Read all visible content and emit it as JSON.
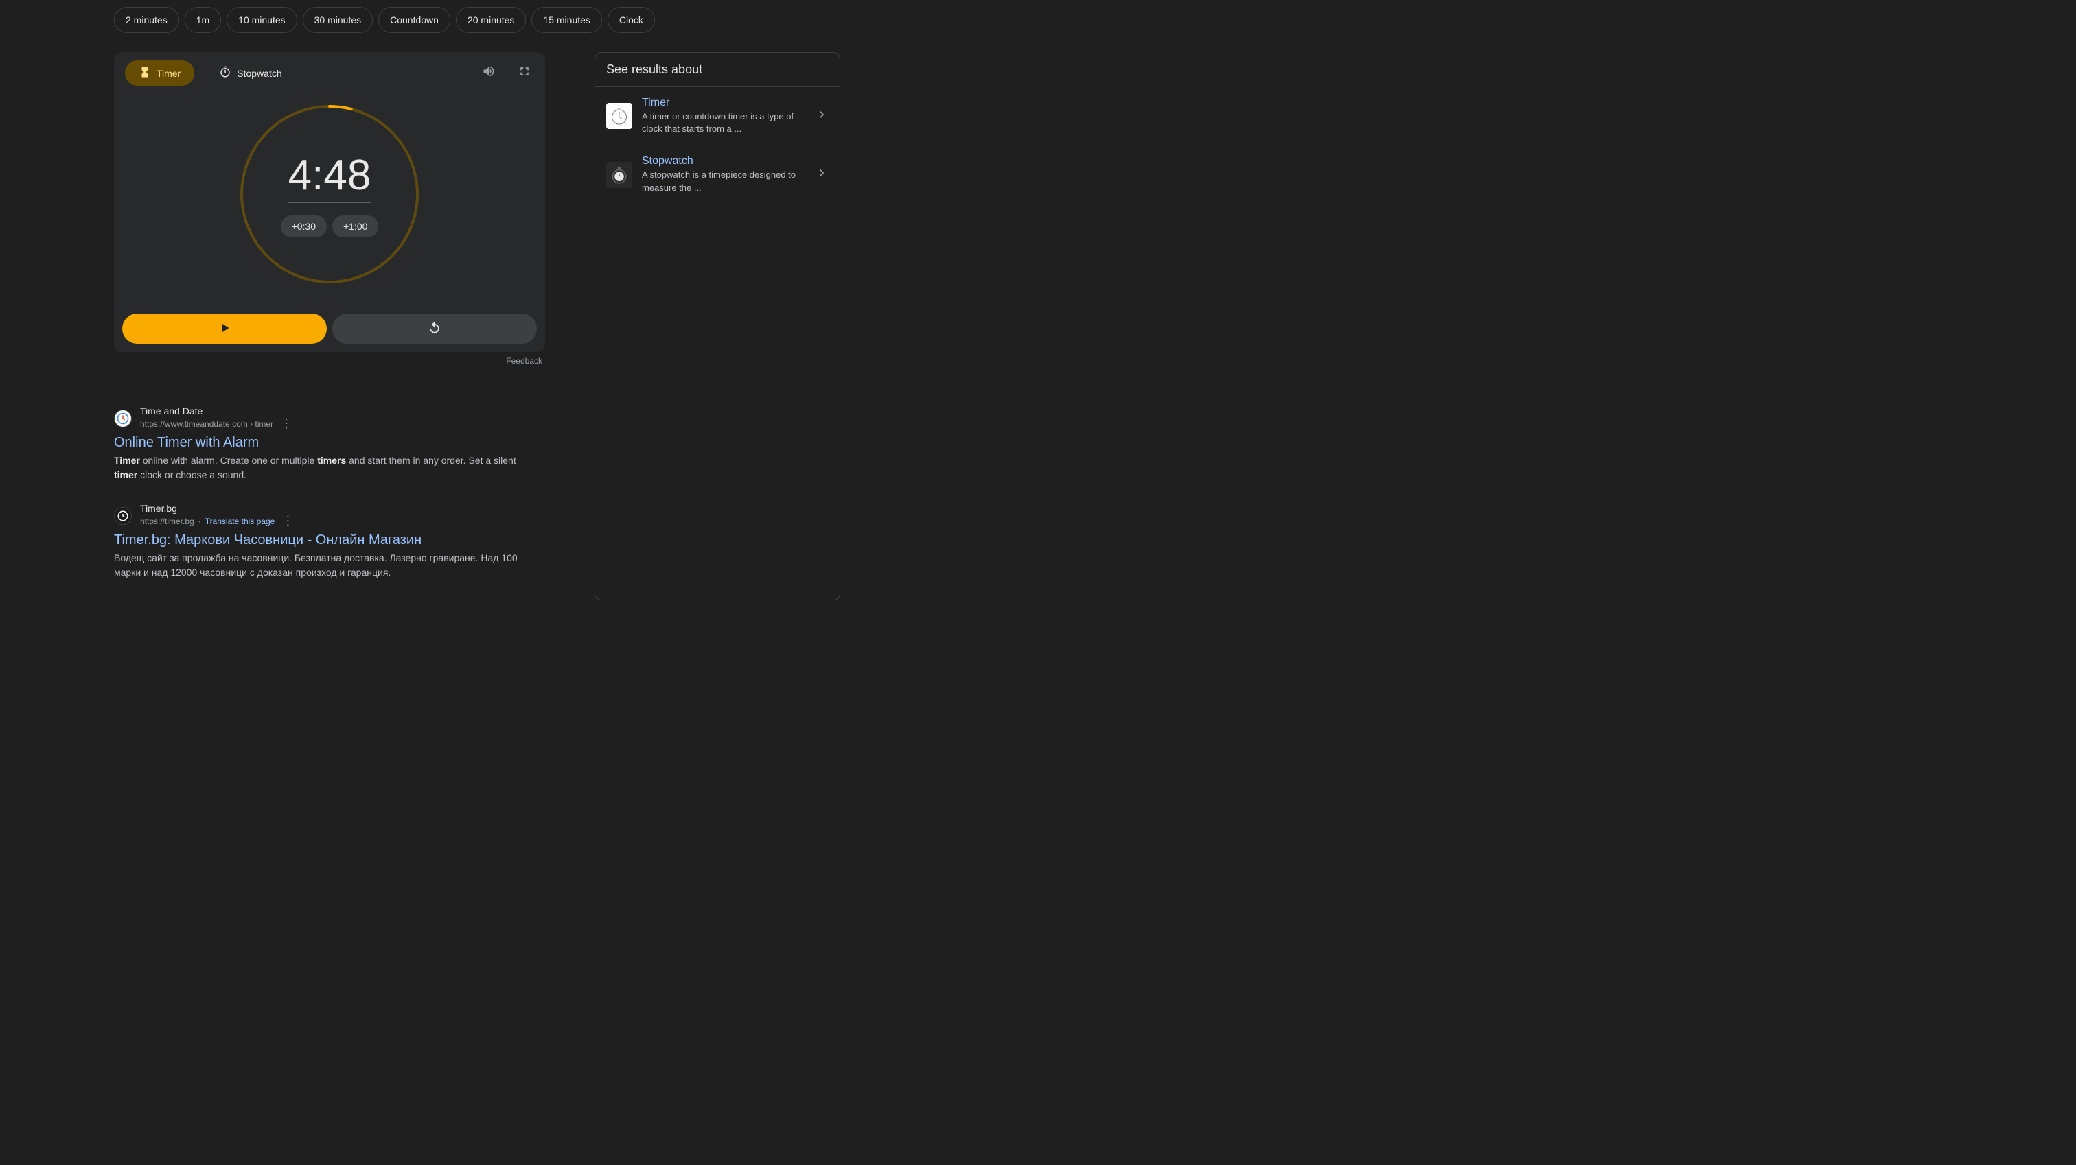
{
  "chips": [
    "2 minutes",
    "1m",
    "10 minutes",
    "30 minutes",
    "Countdown",
    "20 minutes",
    "15 minutes",
    "Clock"
  ],
  "tabs": {
    "timer": "Timer",
    "stopwatch": "Stopwatch"
  },
  "timer": {
    "display": "4:48",
    "add30": "+0:30",
    "add100": "+1:00",
    "progress_percent": 4
  },
  "feedback": "Feedback",
  "knowledge_panel": {
    "title": "See results about",
    "items": [
      {
        "title": "Timer",
        "desc": "A timer or countdown timer is a type of clock that starts from a ..."
      },
      {
        "title": "Stopwatch",
        "desc": "A stopwatch is a timepiece designed to measure the ..."
      }
    ]
  },
  "results": [
    {
      "source_name": "Time and Date",
      "source_url": "https://www.timeanddate.com",
      "source_path": " › timer",
      "title": "Online Timer with Alarm",
      "snippet_pre": "",
      "snippet_b1": "Timer",
      "snippet_mid1": " online with alarm. Create one or multiple ",
      "snippet_b2": "timers",
      "snippet_mid2": " and start them in any order. Set a silent ",
      "snippet_b3": "timer",
      "snippet_end": " clock or choose a sound."
    },
    {
      "source_name": "Timer.bg",
      "source_url": "https://timer.bg",
      "translate_sep": " · ",
      "translate": "Translate this page",
      "title": "Timer.bg: Маркови Часовници - Онлайн Магазин",
      "snippet": "Водещ сайт за продажба на часовници. Безплатна доставка. Лазерно гравиране. Над 100 марки и над 12000 часовници с доказан произход и гаранция."
    }
  ]
}
